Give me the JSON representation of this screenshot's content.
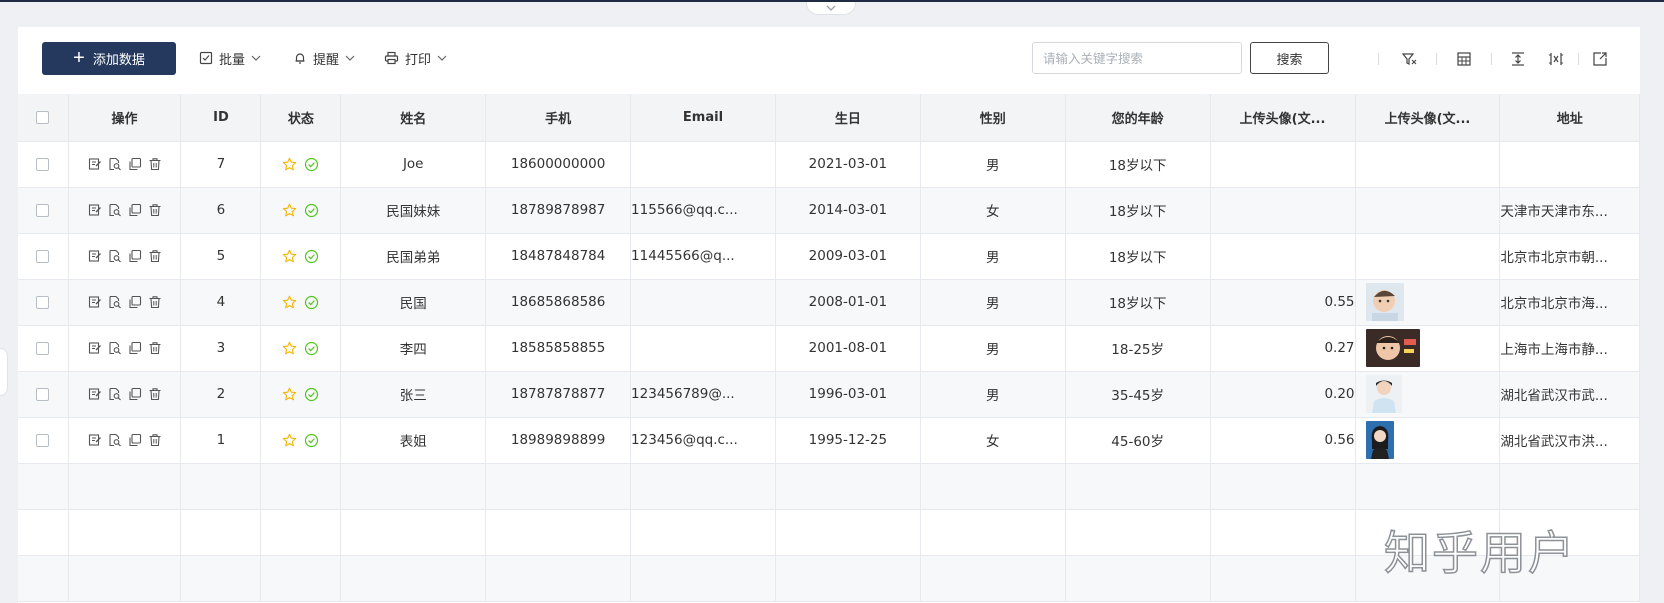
{
  "toolbar": {
    "add_label": "添加数据",
    "batch_label": "批量",
    "remind_label": "提醒",
    "print_label": "打印",
    "search_placeholder": "请输入关键字搜索",
    "search_value": "",
    "search_button": "搜索",
    "icons": [
      "filter-icon",
      "calculator-icon",
      "column-height-icon",
      "column-width-icon",
      "export-icon"
    ]
  },
  "table": {
    "columns": [
      "操作",
      "ID",
      "状态",
      "姓名",
      "手机",
      "Email",
      "生日",
      "性别",
      "您的年龄",
      "上传头像(文...",
      "上传头像(文...",
      "地址"
    ],
    "rows": [
      {
        "id": "7",
        "name": "Joe",
        "phone": "18600000000",
        "email": "",
        "birthday": "2021-03-01",
        "gender": "男",
        "age": "18岁以下",
        "value": "",
        "avatar": "",
        "address": ""
      },
      {
        "id": "6",
        "name": "民国妹妹",
        "phone": "18789878987",
        "email": "115566@qq.c...",
        "birthday": "2014-03-01",
        "gender": "女",
        "age": "18岁以下",
        "value": "",
        "avatar": "",
        "address": "天津市天津市东..."
      },
      {
        "id": "5",
        "name": "民国弟弟",
        "phone": "18487848784",
        "email": "11445566@q...",
        "birthday": "2009-03-01",
        "gender": "男",
        "age": "18岁以下",
        "value": "",
        "avatar": "",
        "address": "北京市北京市朝..."
      },
      {
        "id": "4",
        "name": "民国",
        "phone": "18685868586",
        "email": "",
        "birthday": "2008-01-01",
        "gender": "男",
        "age": "18岁以下",
        "value": "0.55",
        "avatar": "baby-photo",
        "address": "北京市北京市海..."
      },
      {
        "id": "3",
        "name": "李四",
        "phone": "18585858855",
        "email": "",
        "birthday": "2001-08-01",
        "gender": "男",
        "age": "18-25岁",
        "value": "0.27",
        "avatar": "toddler-photo",
        "address": "上海市上海市静..."
      },
      {
        "id": "2",
        "name": "张三",
        "phone": "18787878877",
        "email": "123456789@...",
        "birthday": "1996-03-01",
        "gender": "男",
        "age": "35-45岁",
        "value": "0.20",
        "avatar": "man-photo",
        "address": "湖北省武汉市武..."
      },
      {
        "id": "1",
        "name": "表姐",
        "phone": "18989898899",
        "email": "123456@qq.c...",
        "birthday": "1995-12-25",
        "gender": "女",
        "age": "45-60岁",
        "value": "0.56",
        "avatar": "woman-photo",
        "address": "湖北省武汉市洪..."
      }
    ],
    "empty_rows": 3,
    "row_icons": [
      "edit-icon",
      "view-icon",
      "copy-icon",
      "delete-icon",
      "star-icon",
      "check-circle-icon"
    ]
  },
  "watermark": "知乎用户",
  "colors": {
    "primary": "#24395d",
    "star": "#f5b400",
    "check": "#52c41a",
    "header_bg": "#f3f4f6"
  }
}
